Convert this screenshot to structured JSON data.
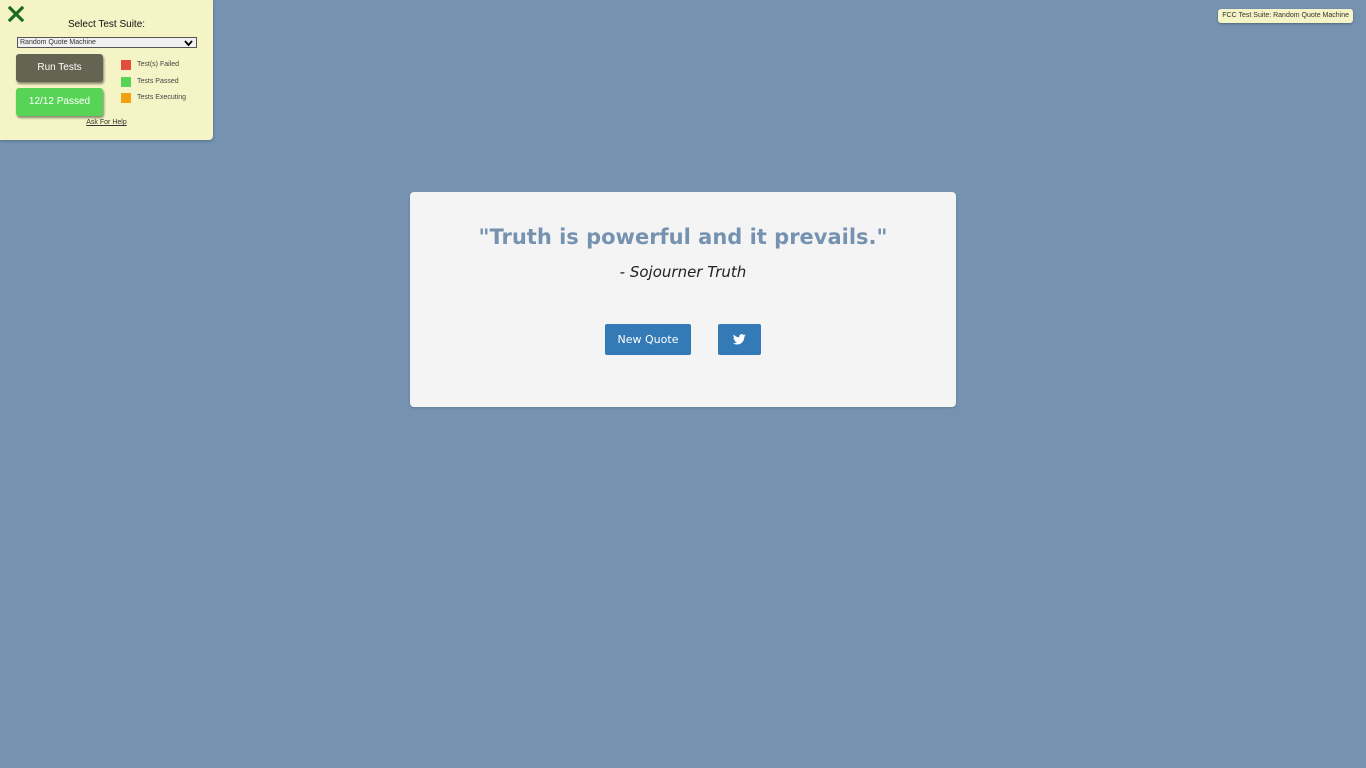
{
  "test_panel": {
    "close_icon": "close-x-icon",
    "title": "Select Test Suite:",
    "suite_select": {
      "value": "Random Quote Machine"
    },
    "run_button": "Run Tests",
    "result_button": "12/12 Passed",
    "legend": [
      {
        "label": "Test(s) Failed",
        "color": "#e34d3c"
      },
      {
        "label": "Tests Passed",
        "color": "#57d456"
      },
      {
        "label": "Tests Executing",
        "color": "#f2a20f"
      }
    ],
    "help_link": "Ask For Help"
  },
  "badge": "FCC Test Suite: Random Quote Machine",
  "quote": {
    "text": "\"Truth is powerful and it prevails.\"",
    "author": "- Sojourner Truth",
    "new_quote_button": "New Quote",
    "tweet_icon": "twitter-icon"
  },
  "colors": {
    "background": "#7592b1",
    "accent": "#337ab7",
    "panel": "#f4f4c6"
  }
}
